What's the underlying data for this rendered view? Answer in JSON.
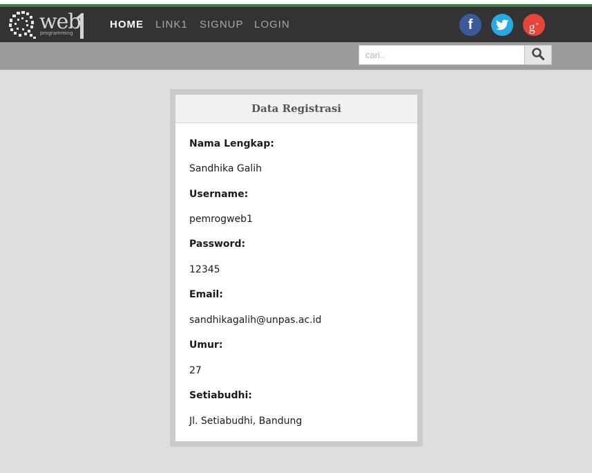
{
  "brand": {
    "name": "web",
    "digit": "1",
    "tagline": "programming"
  },
  "nav": {
    "items": [
      {
        "label": "HOME",
        "active": true
      },
      {
        "label": "LINK1",
        "active": false
      },
      {
        "label": "SIGNUP",
        "active": false
      },
      {
        "label": "LOGIN",
        "active": false
      }
    ]
  },
  "social": {
    "facebook_glyph": "f",
    "google_glyph": "g",
    "google_plus": "+",
    "icons": [
      "facebook-icon",
      "twitter-icon",
      "google-plus-icon"
    ]
  },
  "search": {
    "placeholder": "cari..",
    "value": "",
    "icon": "search-icon"
  },
  "card": {
    "title": "Data Registrasi",
    "fields": [
      {
        "label": "Nama Lengkap:",
        "value": "Sandhika Galih"
      },
      {
        "label": "Username:",
        "value": "pemrogweb1"
      },
      {
        "label": "Password:",
        "value": "12345"
      },
      {
        "label": "Email:",
        "value": "sandhikagalih@unpas.ac.id"
      },
      {
        "label": "Umur:",
        "value": "27"
      },
      {
        "label": "Setiabudhi:",
        "value": "Jl. Setiabudhi, Bandung"
      }
    ]
  },
  "colors": {
    "navbar": "#333333",
    "accent_strip": "#3d7a4f",
    "subbar": "#9c9c9c",
    "facebook": "#3b5a9a",
    "twitter": "#29a9e1",
    "google_plus": "#e7453a"
  }
}
